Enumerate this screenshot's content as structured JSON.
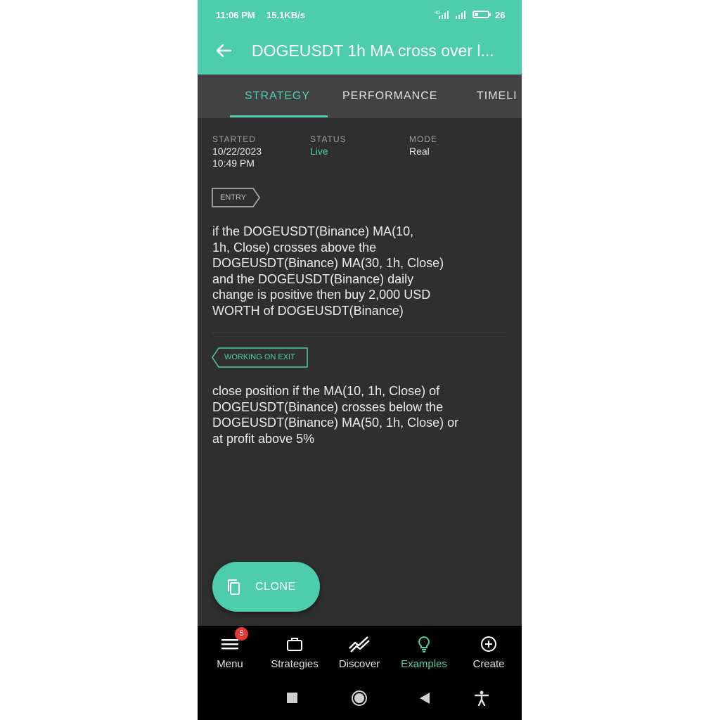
{
  "status_bar": {
    "time": "11:06 PM",
    "network_rate": "15.1KB/s",
    "signal_a": "4G",
    "battery": "26",
    "battery_level_percent": 26
  },
  "app_bar": {
    "title": "DOGEUSDT 1h MA cross over l...",
    "back_icon": "arrow-left-icon"
  },
  "tabs": [
    {
      "label": "STRATEGY",
      "active": true
    },
    {
      "label": "PERFORMANCE",
      "active": false
    },
    {
      "label": "TIMELI",
      "active": false
    }
  ],
  "meta": {
    "started_label": "STARTED",
    "started_date": "10/22/2023",
    "started_time": "10:49 PM",
    "status_label": "STATUS",
    "status_value": "Live",
    "mode_label": "MODE",
    "mode_value": "Real"
  },
  "entry": {
    "tag": "ENTRY",
    "lines": [
      "if the DOGEUSDT(Binance) MA(10,",
      "1h, Close) crosses above the",
      "DOGEUSDT(Binance) MA(30, 1h, Close)",
      "and the DOGEUSDT(Binance) daily",
      "change is positive then buy 2,000 USD",
      "WORTH of DOGEUSDT(Binance)"
    ]
  },
  "exit": {
    "tag": "WORKING ON EXIT",
    "lines": [
      "close position if the MA(10, 1h, Close) of",
      "DOGEUSDT(Binance) crosses below the",
      "DOGEUSDT(Binance) MA(50, 1h, Close) or",
      "at profit above 5%"
    ]
  },
  "fab": {
    "label": "CLONE",
    "icon": "copy-icon"
  },
  "bottom_nav": [
    {
      "label": "Menu",
      "icon": "hamburger-menu-icon",
      "badge": "5",
      "active": false
    },
    {
      "label": "Strategies",
      "icon": "briefcase-icon",
      "active": false
    },
    {
      "label": "Discover",
      "icon": "trend-lines-icon",
      "active": false
    },
    {
      "label": "Examples",
      "icon": "lightbulb-icon",
      "active": true
    },
    {
      "label": "Create",
      "icon": "plus-circle-icon",
      "active": false
    }
  ],
  "system_nav": [
    "recents-square-icon",
    "home-circle-icon",
    "back-triangle-icon",
    "accessibility-icon"
  ],
  "colors": {
    "accent": "#4ecdac",
    "background": "#2f2f2f",
    "tab_bar": "#424242",
    "badge": "#e53935"
  }
}
